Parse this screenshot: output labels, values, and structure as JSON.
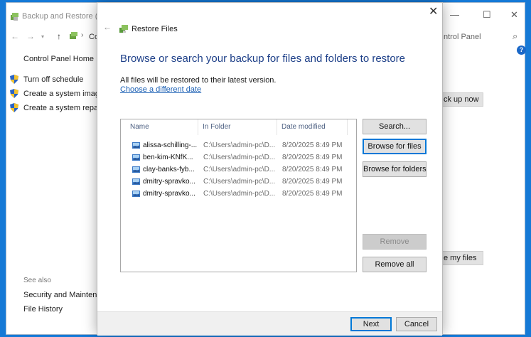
{
  "background_window": {
    "title": "Backup and Restore (Wir",
    "address_fragment": "Co",
    "search_text": "ntrol Panel",
    "home_link": "Control Panel Home",
    "side_links": [
      "Turn off schedule",
      "Create a system image",
      "Create a system repair c"
    ],
    "see_also_label": "See also",
    "see_also_links": [
      "Security and Maintenan",
      "File History"
    ],
    "backup_button": "ck up now",
    "restore_button": "e my files"
  },
  "dialog": {
    "title": "Restore Files",
    "heading": "Browse or search your backup for files and folders to restore",
    "info_text": "All files will be restored to their latest version.",
    "date_link": "Choose a different date",
    "columns": [
      "Name",
      "In Folder",
      "Date modified"
    ],
    "files": [
      {
        "name": "alissa-schilling-...",
        "folder": "C:\\Users\\admin-pc\\D...",
        "date": "8/20/2025 8:49 PM"
      },
      {
        "name": "ben-kim-KNfK...",
        "folder": "C:\\Users\\admin-pc\\D...",
        "date": "8/20/2025 8:49 PM"
      },
      {
        "name": "clay-banks-fyb...",
        "folder": "C:\\Users\\admin-pc\\D...",
        "date": "8/20/2025 8:49 PM"
      },
      {
        "name": "dmitry-spravko...",
        "folder": "C:\\Users\\admin-pc\\D...",
        "date": "8/20/2025 8:49 PM"
      },
      {
        "name": "dmitry-spravko...",
        "folder": "C:\\Users\\admin-pc\\D...",
        "date": "8/20/2025 8:49 PM"
      }
    ],
    "buttons": {
      "search": "Search...",
      "browse_files": "Browse for files",
      "browse_folders": "Browse for folders",
      "remove": "Remove",
      "remove_all": "Remove all",
      "next": "Next",
      "cancel": "Cancel"
    }
  },
  "colors": {
    "desktop": "#1579d6",
    "heading": "#1d3f88",
    "link": "#1a5fb4",
    "focus_border": "#0078d7"
  }
}
